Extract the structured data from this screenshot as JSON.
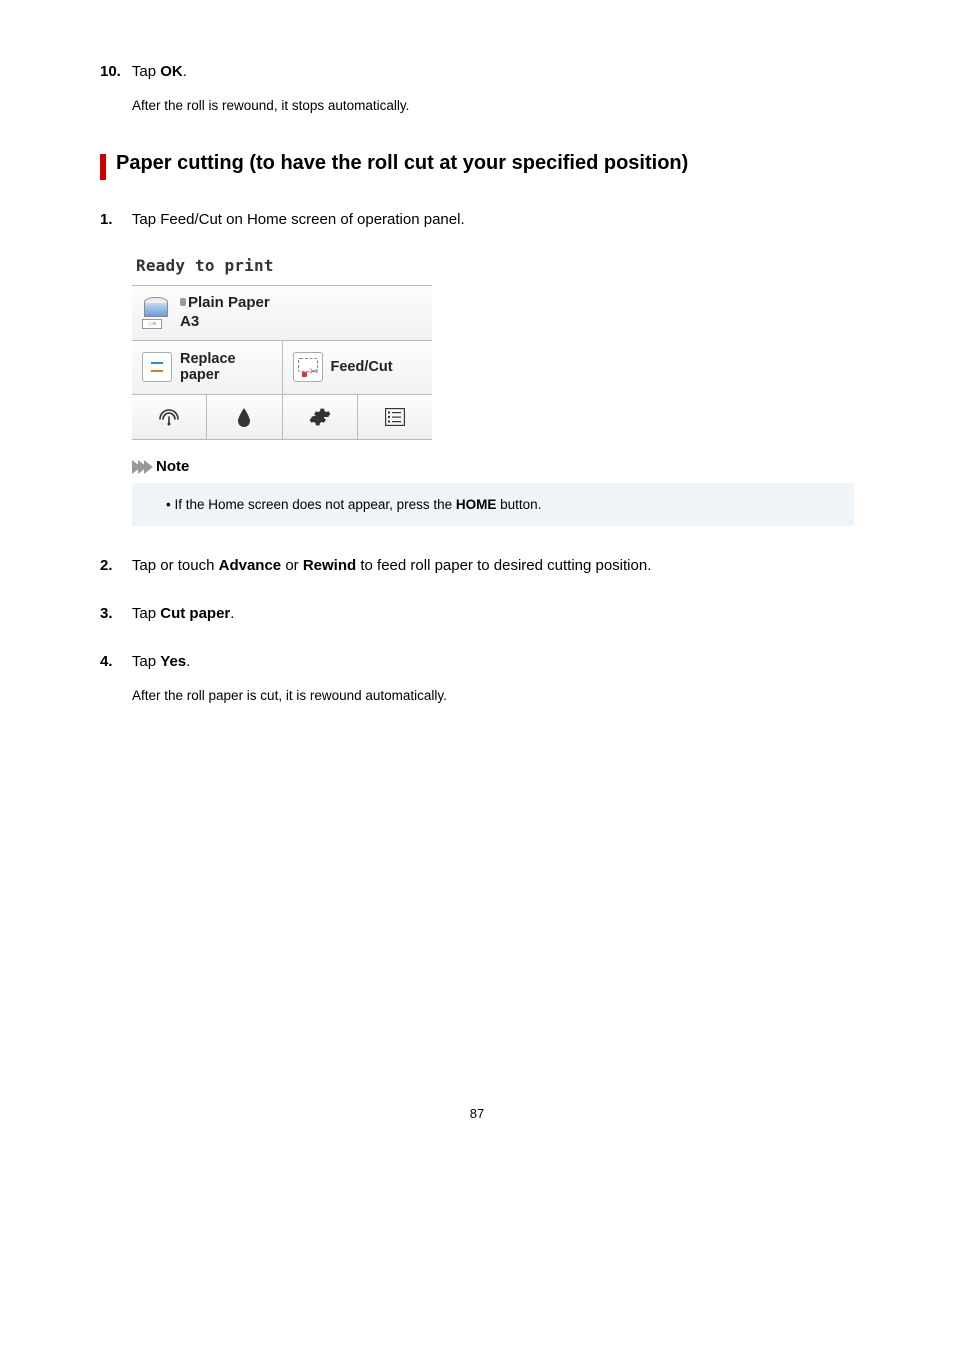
{
  "step10": {
    "num": "10.",
    "text_prefix": "Tap ",
    "text_bold": "OK",
    "text_suffix": ".",
    "sub": "After the roll is rewound, it stops automatically."
  },
  "section_title": "Paper cutting (to have the roll cut at your specified position)",
  "step1": {
    "num": "1.",
    "text": "Tap Feed/Cut on Home screen of operation panel."
  },
  "panel": {
    "status": "Ready to print",
    "paper_type": "Plain Paper",
    "paper_size": "A3",
    "replace_label": "Replace\npaper",
    "feed_label": "Feed/Cut"
  },
  "note": {
    "label": "Note",
    "item_prefix": "If the Home screen does not appear, press the ",
    "item_bold": "HOME",
    "item_suffix": " button."
  },
  "step2": {
    "num": "2.",
    "p1": "Tap or touch ",
    "b1": "Advance",
    "p2": " or ",
    "b2": "Rewind",
    "p3": " to feed roll paper to desired cutting position."
  },
  "step3": {
    "num": "3.",
    "p1": "Tap ",
    "b1": "Cut paper",
    "p2": "."
  },
  "step4": {
    "num": "4.",
    "p1": "Tap ",
    "b1": "Yes",
    "p2": ".",
    "sub": "After the roll paper is cut, it is rewound automatically."
  },
  "page_number": "87"
}
